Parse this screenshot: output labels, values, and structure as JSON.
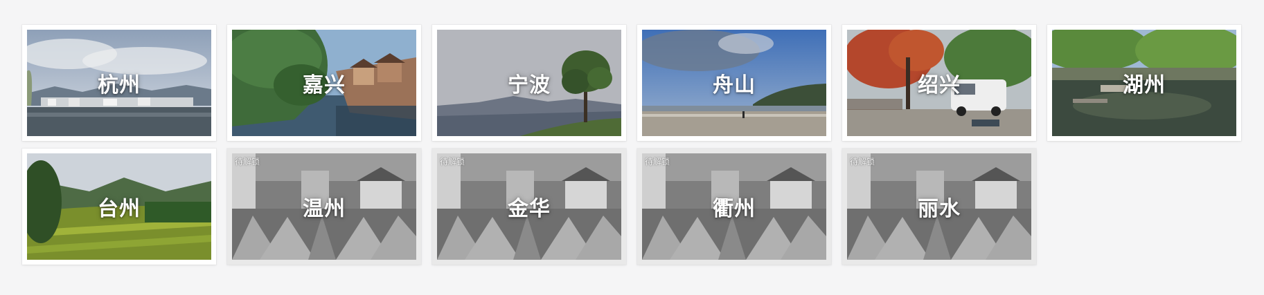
{
  "locked_badge": "待解锁",
  "cities": [
    {
      "name": "杭州",
      "scene": "lake-town",
      "locked": false
    },
    {
      "name": "嘉兴",
      "scene": "water-town",
      "locked": false
    },
    {
      "name": "宁波",
      "scene": "hill-tree",
      "locked": false
    },
    {
      "name": "舟山",
      "scene": "beach",
      "locked": false
    },
    {
      "name": "绍兴",
      "scene": "autumn-van",
      "locked": false
    },
    {
      "name": "湖州",
      "scene": "stream",
      "locked": false
    },
    {
      "name": "台州",
      "scene": "rice-field",
      "locked": false
    },
    {
      "name": "温州",
      "scene": "locked-village",
      "locked": true
    },
    {
      "name": "金华",
      "scene": "locked-village",
      "locked": true
    },
    {
      "name": "衢州",
      "scene": "locked-village",
      "locked": true
    },
    {
      "name": "丽水",
      "scene": "locked-village",
      "locked": true
    }
  ],
  "colors": {
    "page_bg": "#f5f5f6",
    "card_bg": "#ffffff",
    "label": "#ffffff"
  }
}
